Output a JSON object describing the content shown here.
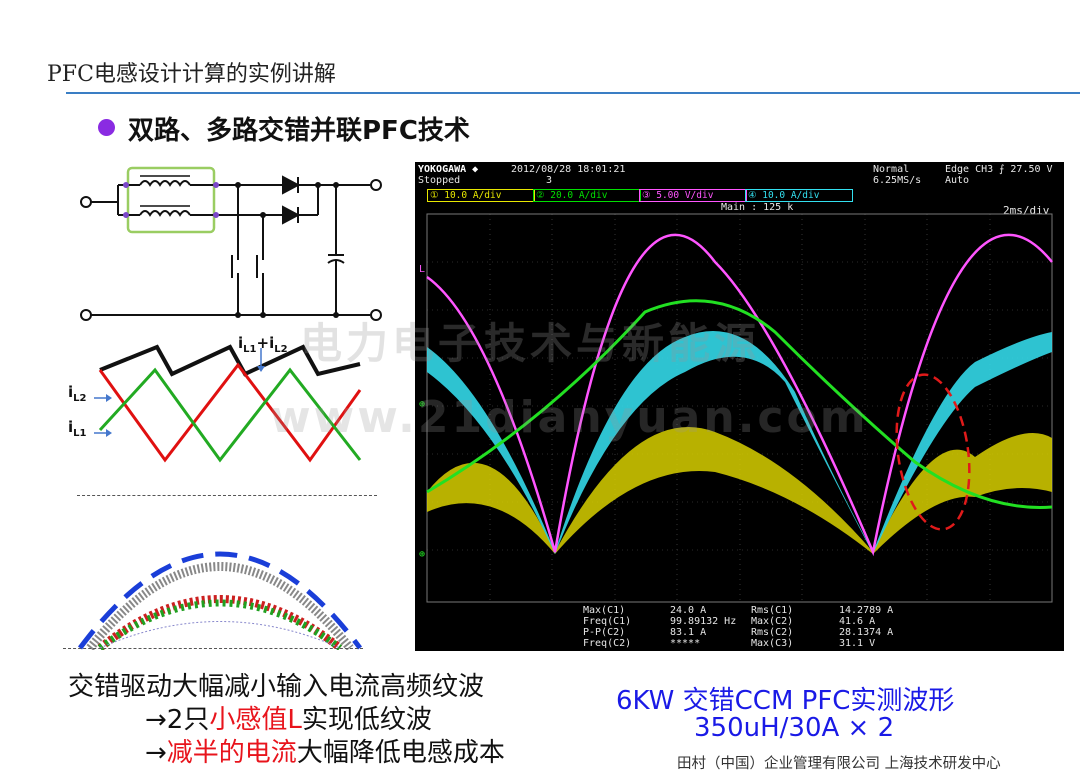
{
  "slide": {
    "title": "PFC电感设计计算的实例讲解",
    "bullet": "双路、多路交错并联PFC技术",
    "colors": {
      "title_rule": "#3a7ec4",
      "bullet": "#8a2be2",
      "red": "#e8141c",
      "blue": "#1a1ae6"
    }
  },
  "ripple_diagram": {
    "label_sum": "iL1+iL2",
    "label_sum_parts": {
      "a": "i",
      "a_sub": "L1",
      "plus": "+i",
      "b_sub": "L2"
    },
    "label_l2": {
      "main": "i",
      "sub": "L2"
    },
    "label_l1": {
      "main": "i",
      "sub": "L1"
    }
  },
  "scope": {
    "brand": "YOKOGAWA ◆",
    "datetime": "2012/08/28 18:01:21",
    "state": "Stopped",
    "record_no": "3",
    "mode": "Normal",
    "sample_rate": "6.25MS/s",
    "trigger": "Edge CH3 ⨍ 27.50 V",
    "trigger_mode": "Auto",
    "main_points": "Main : 125 k",
    "timebase": "2ms/div",
    "channels": [
      {
        "label": "① 10.0 A/div",
        "color": "#e8e800"
      },
      {
        "label": "② 20.0 A/div",
        "color": "#00e000"
      },
      {
        "label": "③ 5.00 V/div",
        "color": "#ff55ff"
      },
      {
        "label": "④ 10.0 A/div",
        "color": "#33e0f0"
      }
    ],
    "measurements_col1": [
      "Max(C1)",
      "Freq(C1)",
      "P-P(C2)",
      "Freq(C2)"
    ],
    "measurements_col2": [
      "24.0 A",
      "99.89132 Hz",
      "83.1 A",
      "*****"
    ],
    "measurements_col3": [
      "Rms(C1)",
      "Max(C2)",
      "Rms(C2)",
      "Max(C3)"
    ],
    "measurements_col4": [
      "14.2789 A",
      "41.6 A",
      "28.1374 A",
      "31.1 V"
    ]
  },
  "watermark": {
    "line1": "电力电子技术与新能源",
    "line2": "www.21dianyuan.com"
  },
  "caption_left": {
    "line1": "交错驱动大幅减小输入电流高频纹波",
    "line2_prefix": "→2只",
    "line2_red": "小感值L",
    "line2_suffix": "实现低纹波",
    "line3_prefix": "→",
    "line3_red": "减半的电流",
    "line3_suffix": "大幅降低电感成本"
  },
  "caption_right": {
    "line1": "6KW 交错CCM PFC实测波形",
    "line2": "350uH/30A × 2"
  },
  "footer": "田村（中国）企业管理有限公司 上海技术研发中心"
}
